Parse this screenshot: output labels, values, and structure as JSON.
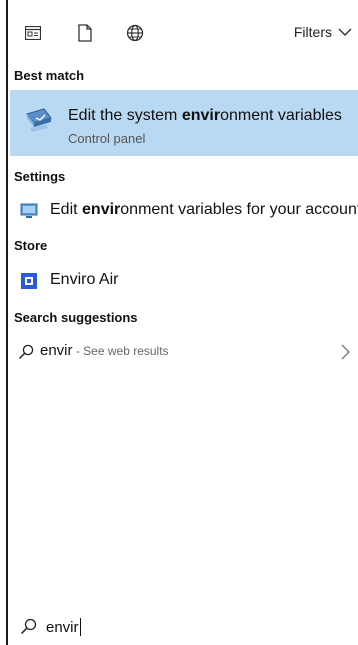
{
  "toolbar": {
    "filters_label": "Filters",
    "icons": [
      "apps-icon",
      "documents-icon",
      "web-icon"
    ]
  },
  "sections": {
    "best_match": "Best match",
    "settings": "Settings",
    "store": "Store",
    "search_suggestions": "Search suggestions"
  },
  "best_match_item": {
    "title_prefix": "Edit the system ",
    "title_highlight": "envir",
    "title_suffix": "onment variables",
    "subtitle": "Control panel",
    "icon": "control-panel-icon"
  },
  "settings_item": {
    "prefix": "Edit ",
    "highlight": "envir",
    "suffix": "onment variables for your account",
    "icon": "settings-monitor-icon"
  },
  "store_item": {
    "label": "Enviro Air",
    "icon": "app-tile-icon"
  },
  "suggestion": {
    "query": "envir",
    "hint": " - See web results"
  },
  "search": {
    "value": "envir"
  },
  "colors": {
    "selection": "#b8d9f1",
    "accent": "#2a5bd7"
  }
}
